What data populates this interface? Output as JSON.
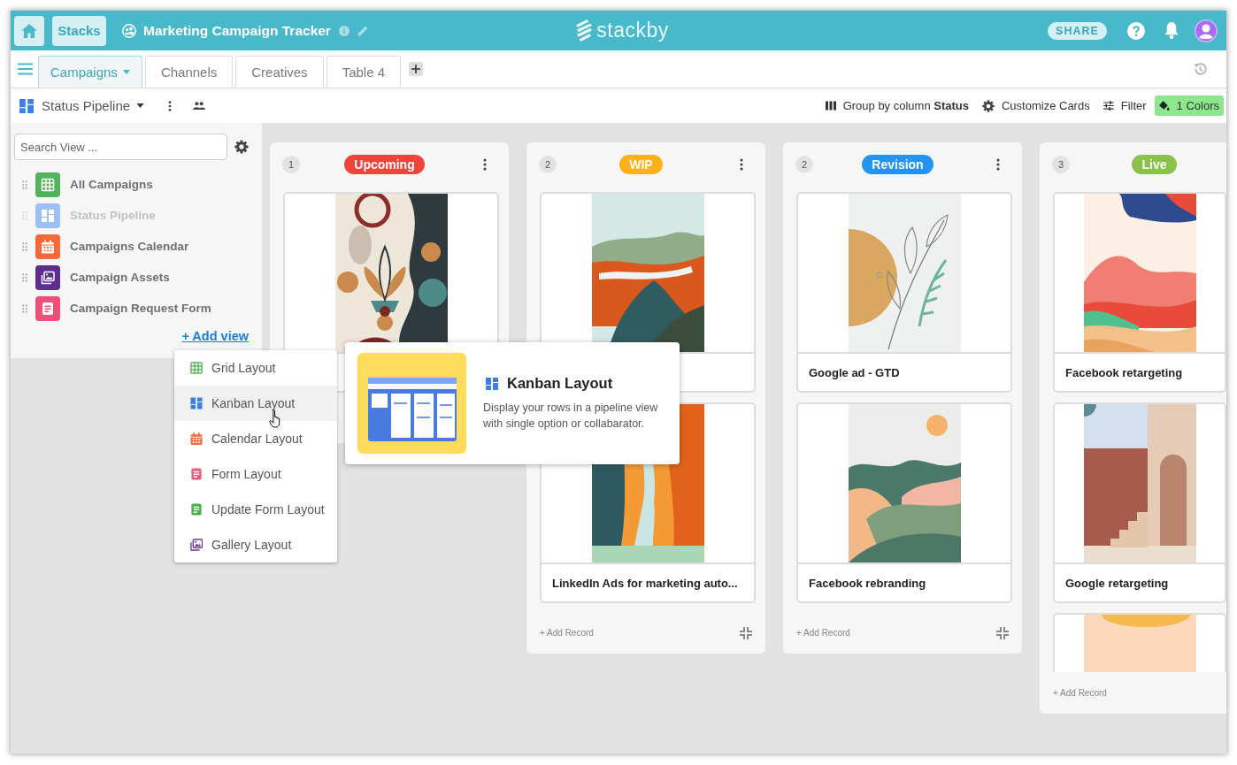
{
  "header": {
    "stacks_button": "Stacks",
    "title": "Marketing Campaign Tracker",
    "logo": "stackby",
    "share_button": "SHARE"
  },
  "tabs": [
    {
      "label": "Campaigns",
      "selected": true
    },
    {
      "label": "Channels",
      "selected": false
    },
    {
      "label": "Creatives",
      "selected": false
    },
    {
      "label": "Table 4",
      "selected": false
    }
  ],
  "toolbar": {
    "view_name": "Status Pipeline",
    "tools": [
      {
        "kind": "group",
        "label": "Group by column **Status**",
        "active": false
      },
      {
        "kind": "customize",
        "label": "Customize Cards",
        "active": false
      },
      {
        "kind": "filter",
        "label": "Filter",
        "active": false
      },
      {
        "kind": "colors",
        "label": "1 Colors",
        "active": true
      }
    ]
  },
  "sidebar": {
    "search": {
      "placeholder": "Search View ..."
    },
    "views": [
      {
        "kind": "grid",
        "color": "#52b35a",
        "label": "All Campaigns",
        "selected": false
      },
      {
        "kind": "kanban",
        "color": "#9cbff6",
        "label": "Status Pipeline",
        "selected": true
      },
      {
        "kind": "calendar",
        "color": "#f9683b",
        "label": "Campaigns Calendar",
        "selected": false
      },
      {
        "kind": "gallery",
        "color": "#5d2e90",
        "label": "Campaign Assets",
        "selected": false
      },
      {
        "kind": "form",
        "color": "#ec5079",
        "label": "Campaign Request Form",
        "selected": false
      }
    ],
    "add_view": "+ Add view"
  },
  "layout_menu": [
    {
      "kind": "grid",
      "color": "#5cb85c",
      "label": "Grid Layout",
      "highlighted": false
    },
    {
      "kind": "kanban",
      "color": "#3b7fe8",
      "label": "Kanban Layout",
      "highlighted": true
    },
    {
      "kind": "calendar",
      "color": "#ff6a3d",
      "label": "Calendar Layout",
      "highlighted": false
    },
    {
      "kind": "form",
      "color": "#ee5a7d",
      "label": "Form Layout",
      "highlighted": false
    },
    {
      "kind": "form",
      "color": "#4caf50",
      "label": "Update Form Layout",
      "highlighted": false
    },
    {
      "kind": "gallery",
      "color": "#6a3aa0",
      "label": "Gallery Layout",
      "highlighted": false
    }
  ],
  "popover": {
    "title": "Kanban Layout",
    "description": "Display your rows in a pipeline view with single option or collabarator."
  },
  "board": {
    "columns": [
      {
        "count": "1",
        "status": "Upcoming",
        "color": "#f0433a",
        "more_menu": true,
        "cards": [
          {
            "image": true
          }
        ],
        "collapse_button": false
      },
      {
        "count": "2",
        "status": "WIP",
        "color": "#fbb117",
        "more_menu": true,
        "cards": [
          {
            "image": true
          },
          {
            "image": true,
            "title": "LinkedIn Ads for marketing auto..."
          }
        ],
        "add_record": "+ Add Record",
        "collapse_button": true
      },
      {
        "count": "2",
        "status": "Revision",
        "color": "#2394f0",
        "more_menu": true,
        "cards": [
          {
            "image": true,
            "title": "Google ad - GTD"
          },
          {
            "image": true,
            "title": "Facebook rebranding"
          }
        ],
        "add_record": "+ Add Record",
        "collapse_button": true
      },
      {
        "count": "3",
        "status": "Live",
        "color": "#8bc34a",
        "more_menu": false,
        "cards": [
          {
            "image": true,
            "title": "Facebook retargeting"
          },
          {
            "image": true,
            "title": "Google retargeting"
          },
          {
            "image": true
          }
        ],
        "add_record": "+ Add Record",
        "collapse_button": false
      }
    ]
  }
}
